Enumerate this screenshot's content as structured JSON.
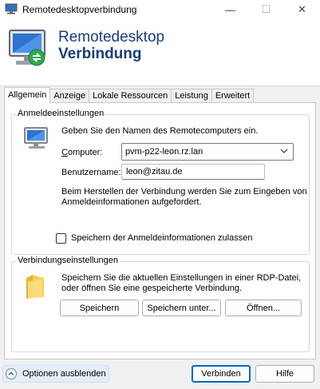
{
  "window": {
    "title": "Remotedesktopverbindung",
    "controls": {
      "minimize": "—",
      "maximize": "☐",
      "close": "✕"
    }
  },
  "banner": {
    "title_line1": "Remotedesktop",
    "title_line2": "Verbindung",
    "icon": "remote-desktop-monitor-icon"
  },
  "tabs": [
    {
      "label": "Allgemein",
      "active": true
    },
    {
      "label": "Anzeige",
      "active": false
    },
    {
      "label": "Lokale Ressourcen",
      "active": false
    },
    {
      "label": "Leistung",
      "active": false
    },
    {
      "label": "Erweitert",
      "active": false
    }
  ],
  "logon": {
    "legend": "Anmeldeeinstellungen",
    "instruction": "Geben Sie den Namen des Remotecomputers ein.",
    "computer_label": "Computer:",
    "computer_value": "pvm-p22-leon.rz.lan",
    "username_label": "Benutzername:",
    "username_value": "leon@zitau.de",
    "prompt_line1": "Beim Herstellen der Verbindung werden Sie zum Eingeben von",
    "prompt_line2": "Anmeldeinformationen aufgefordert.",
    "save_credentials_label": "Speichern der Anmeldeinformationen zulassen",
    "save_credentials_checked": false
  },
  "connection": {
    "legend": "Verbindungseinstellungen",
    "desc_line1": "Speichern Sie die aktuellen Einstellungen in einer RDP-Datei,",
    "desc_line2": "oder öffnen Sie eine gespeicherte Verbindung.",
    "save_button": "Speichern",
    "save_as_button": "Speichern unter...",
    "open_button": "Öffnen..."
  },
  "footer": {
    "options_toggle": "Optionen ausblenden",
    "connect_button": "Verbinden",
    "help_button": "Hilfe"
  },
  "colors": {
    "brand_text": "#1b3c78",
    "accent": "#0067c0"
  }
}
